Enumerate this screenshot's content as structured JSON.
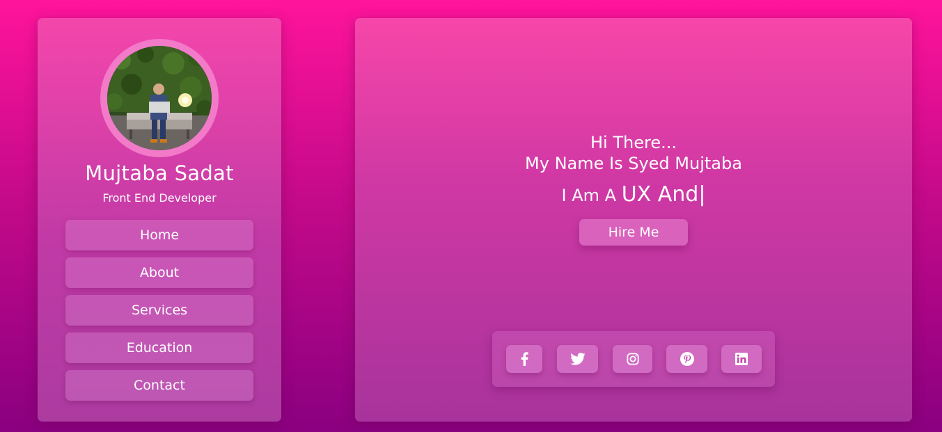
{
  "profile": {
    "avatar_icon": "avatar-photo",
    "name": "Mujtaba Sadat",
    "role": "Front End Developer"
  },
  "nav": {
    "items": [
      {
        "label": "Home"
      },
      {
        "label": "About"
      },
      {
        "label": "Services"
      },
      {
        "label": "Education"
      },
      {
        "label": "Contact"
      }
    ]
  },
  "hero": {
    "greeting_line1": "Hi There...",
    "greeting_line2": "My Name Is Syed Mujtaba",
    "tagline_prefix": "I Am A ",
    "tagline_typed": "UX And|",
    "cta_label": "Hire Me"
  },
  "social": {
    "icons": [
      "facebook-icon",
      "twitter-icon",
      "instagram-icon",
      "pinterest-icon",
      "linkedin-icon"
    ]
  },
  "colors": {
    "background_top": "#ff149b",
    "background_bottom": "#8a0080",
    "card_top": "#f446ab",
    "avatar_ring": "#f27ac8",
    "text": "#ffffff"
  }
}
